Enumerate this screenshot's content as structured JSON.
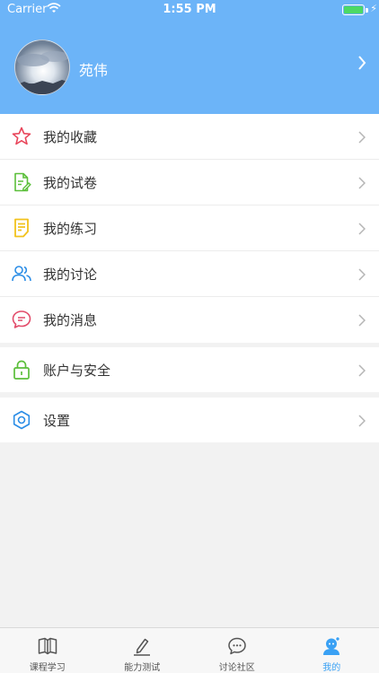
{
  "status_bar": {
    "carrier": "Carrier",
    "time": "1:55 PM"
  },
  "profile": {
    "name": "苑伟"
  },
  "menu": {
    "group1": [
      {
        "label": "我的收藏",
        "icon": "star-icon"
      },
      {
        "label": "我的试卷",
        "icon": "exam-paper-icon"
      },
      {
        "label": "我的练习",
        "icon": "practice-note-icon"
      },
      {
        "label": "我的讨论",
        "icon": "users-icon"
      },
      {
        "label": "我的消息",
        "icon": "message-icon"
      }
    ],
    "group2": [
      {
        "label": "账户与安全",
        "icon": "lock-icon"
      }
    ],
    "group3": [
      {
        "label": "设置",
        "icon": "gear-icon"
      }
    ]
  },
  "tabbar": [
    {
      "label": "课程学习",
      "icon": "book-icon"
    },
    {
      "label": "能力测试",
      "icon": "pen-icon"
    },
    {
      "label": "讨论社区",
      "icon": "chat-bubble-icon"
    },
    {
      "label": "我的",
      "icon": "profile-icon",
      "active": true
    }
  ],
  "colors": {
    "header": "#6cb4f8",
    "active_tab": "#3aa1f4"
  }
}
